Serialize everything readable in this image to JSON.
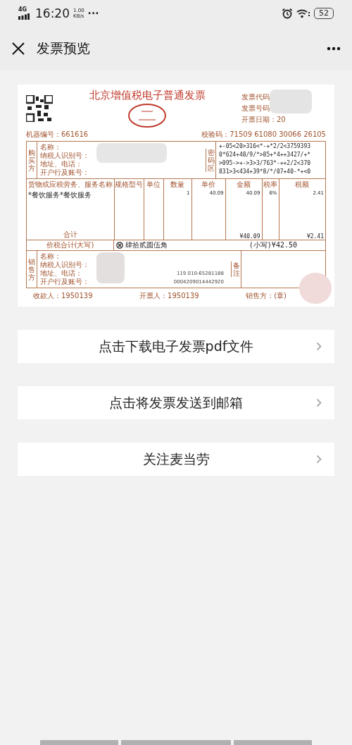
{
  "status_bar": {
    "network": "4G",
    "time": "16:20",
    "speed_value": "1.00",
    "speed_unit": "KB/s",
    "more": "···",
    "battery": "52"
  },
  "header": {
    "title": "发票预览"
  },
  "invoice": {
    "machine_no": "机器编号：661616",
    "title": "北京增值税电子普通发票",
    "meta": [
      "发票代码",
      "发票号码",
      "开票日期：20",
      "校验码：71509 61080 30066 26105"
    ],
    "buyer": {
      "side": "购买方",
      "labels": [
        "名称：",
        "纳税人识别号：",
        "地址、电话：",
        "开户行及账号："
      ],
      "cipher_label": "密码区",
      "cipher": [
        "+-05<20>316<*-+*2/2<3759393",
        "0*624+48/9/*>85+*4++3427/+*",
        ">095->+->3>3/763*-++2/2<370",
        "831>3<434+39*8/*/07+40-*+<0"
      ]
    },
    "goods": {
      "columns": [
        "货物或应税劳务、服务名称",
        "规格型号",
        "单位",
        "数量",
        "单价",
        "金额",
        "税率",
        "税额"
      ],
      "rows": [
        {
          "name": "*餐饮服务*餐饮服务",
          "quantity": "1",
          "unit_price": "40.09",
          "amount": "40.09",
          "tax_rate": "6%",
          "tax": "2.41"
        }
      ],
      "total_label": "合计",
      "total_amount": "¥40.09",
      "total_tax": "¥2.41"
    },
    "sum": {
      "label": "价税合计(大写)",
      "words": "肆拾贰圆伍角",
      "small": "(小写)¥42.50"
    },
    "seller": {
      "side": "销售方",
      "labels": [
        "名称：",
        "纳税人识别号：",
        "地址、电话：",
        "开户行及账号："
      ],
      "extra": [
        "119 010-65281188",
        "0004209014442920"
      ],
      "remark_label": "备注"
    },
    "footer": [
      "收款人：1950139",
      "开票人：1950139",
      "销售方：(章)"
    ]
  },
  "actions": [
    {
      "label": "点击下载电子发票pdf文件"
    },
    {
      "label": "点击将发票发送到邮箱"
    },
    {
      "label": "关注麦当劳"
    }
  ]
}
